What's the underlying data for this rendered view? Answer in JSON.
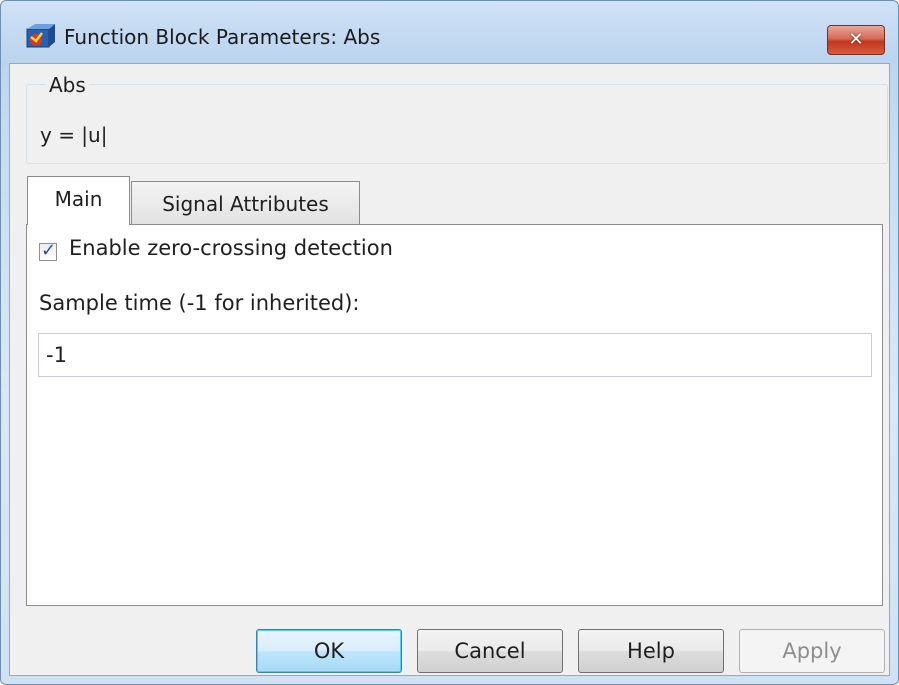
{
  "window": {
    "title": "Function Block Parameters: Abs",
    "close_glyph": "✕",
    "app_icon": "simulink-block-icon"
  },
  "group": {
    "title": "Abs",
    "description": "y = |u|"
  },
  "tabs": [
    {
      "label": "Main",
      "selected": true
    },
    {
      "label": "Signal Attributes",
      "selected": false
    }
  ],
  "main": {
    "zero_crossing_label": "Enable zero-crossing detection",
    "zero_crossing_checked": true,
    "sample_time_label": "Sample time (-1 for inherited):",
    "sample_time_value": "-1"
  },
  "buttons": {
    "ok": "OK",
    "cancel": "Cancel",
    "help": "Help",
    "apply": "Apply"
  },
  "colors": {
    "close_button": "#c3381f",
    "default_button_border": "#3c7fb1",
    "checkbox_mark": "#2a4ba8"
  }
}
